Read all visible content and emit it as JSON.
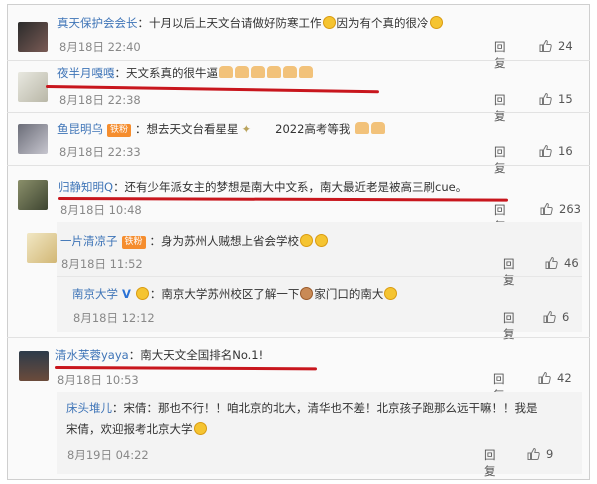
{
  "comments": [
    {
      "name": "真天保护会会长",
      "text": "：十月以后上天文台请做好防寒工作",
      "text2": "因为有个真的很冷",
      "time": "8月18日 22:40",
      "reply": "回复",
      "likes": "24"
    },
    {
      "name": "夜半月嘎嘎",
      "text": "：天文系真的很牛逼",
      "time": "8月18日 22:38",
      "reply": "回复",
      "likes": "15"
    },
    {
      "name": "鱼昆明乌",
      "badge": "铁粉",
      "text": "：想去天文台看星星",
      "text2": "2022高考等我",
      "time": "8月18日 22:33",
      "reply": "回复",
      "likes": "16"
    },
    {
      "name": "归静知明Q",
      "text": "：还有少年派女主的梦想是南大中文系，南大最近老是被高三刷cue。",
      "time": "8月18日 10:48",
      "reply": "回复",
      "likes": "263"
    },
    {
      "name": "一片清凉子",
      "badge": "铁粉",
      "text": "：身为苏州人贼想上省会学校",
      "time": "8月18日 11:52",
      "reply": "回复",
      "likes": "46"
    },
    {
      "name": "南京大学",
      "text": "：南京大学苏州校区了解一下",
      "text2": "家门口的南大",
      "time": "8月18日 12:12",
      "reply": "回复",
      "likes": "6"
    },
    {
      "name": "清水芙蓉yaya",
      "text": "：南大天文全国排名No.1!",
      "time": "8月18日 10:53",
      "reply": "回复",
      "likes": "42"
    },
    {
      "name": "床头堆儿",
      "text": "：宋倩：那也不行！！咱北京的北大，清华也不差！北京孩子跑那么远干嘛！！我是",
      "text_line2": "宋倩，欢迎报考北京大学",
      "time": "8月19日 04:22",
      "reply": "回复",
      "likes": "9"
    }
  ],
  "colors": {
    "name": "#3e74b7",
    "underline": "#c8161d",
    "badge": "#f58d2e"
  },
  "icons": [
    "thumbs-up-icon",
    "emoji-face-icon",
    "thumbs-up-hand-emoji",
    "verified-v-icon"
  ]
}
